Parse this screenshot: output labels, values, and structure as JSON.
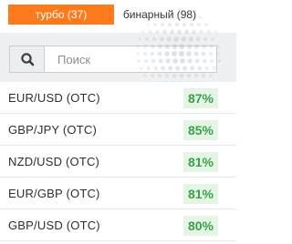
{
  "tabs": [
    {
      "label": "турбо (37)",
      "active": true
    },
    {
      "label": "бинарный (98)",
      "active": false
    }
  ],
  "search": {
    "placeholder": "Поиск",
    "value": ""
  },
  "assets": [
    {
      "name": "EUR/USD (OTC)",
      "payout": "87%"
    },
    {
      "name": "GBP/JPY (OTC)",
      "payout": "85%"
    },
    {
      "name": "NZD/USD (OTC)",
      "payout": "81%"
    },
    {
      "name": "EUR/GBP (OTC)",
      "payout": "81%"
    },
    {
      "name": "GBP/USD (OTC)",
      "payout": "80%"
    }
  ],
  "icons": {
    "search": "search-icon",
    "globe": "globe-dots-icon"
  },
  "colors": {
    "accent": "#ff7a1a",
    "payout_text": "#37a24a",
    "payout_bg": "#e6f4e6"
  }
}
